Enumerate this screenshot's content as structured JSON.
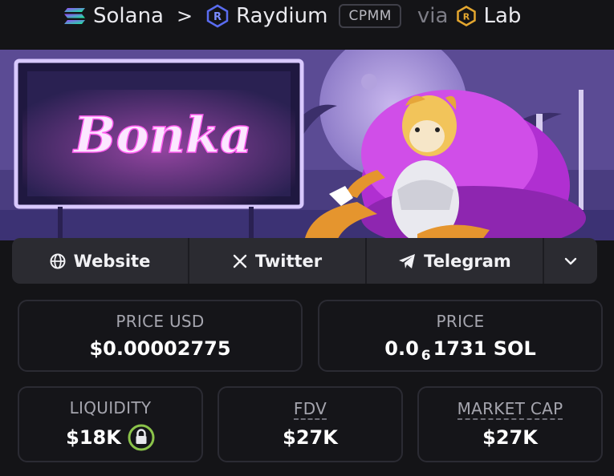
{
  "breadcrumb": {
    "chain": "Solana",
    "separator": ">",
    "dex": "Raydium",
    "pool_type": "CPMM",
    "via": "via",
    "source": "Lab"
  },
  "banner": {
    "sign_text": "Bonka"
  },
  "socials": {
    "website": "Website",
    "twitter": "Twitter",
    "telegram": "Telegram"
  },
  "stats": {
    "price_usd_label": "PRICE USD",
    "price_usd_value": "$0.00002775",
    "price_label": "PRICE",
    "price_prefix": "0.0",
    "price_zero_count": "6",
    "price_suffix": "1731 SOL",
    "liquidity_label": "LIQUIDITY",
    "liquidity_value": "$18K",
    "fdv_label": "FDV",
    "fdv_value": "$27K",
    "market_cap_label": "MARKET CAP",
    "market_cap_value": "$27K"
  },
  "colors": {
    "background": "#141417",
    "card_border": "#2b2b33",
    "social_bar": "#2b2b31",
    "lock_green": "#8bc34a",
    "neon_pink": "#e040fb"
  },
  "icons": {
    "chain": "solana-icon",
    "dex": "raydium-icon",
    "source": "lab-icon",
    "website": "globe-icon",
    "twitter": "x-icon",
    "telegram": "telegram-icon",
    "more": "chevron-down-icon",
    "liquidity": "lock-icon"
  }
}
